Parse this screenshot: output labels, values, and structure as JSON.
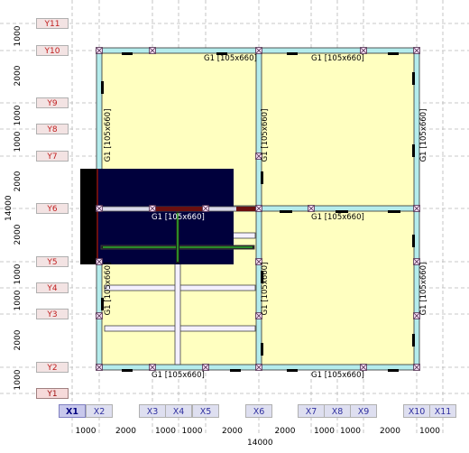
{
  "y_axes": [
    {
      "label": "Y11",
      "selected": false
    },
    {
      "label": "Y10",
      "selected": false
    },
    {
      "label": "Y9",
      "selected": false
    },
    {
      "label": "Y8",
      "selected": false
    },
    {
      "label": "Y7",
      "selected": false
    },
    {
      "label": "Y6",
      "selected": false
    },
    {
      "label": "Y5",
      "selected": false
    },
    {
      "label": "Y4",
      "selected": false
    },
    {
      "label": "Y3",
      "selected": false
    },
    {
      "label": "Y2",
      "selected": false
    },
    {
      "label": "Y1",
      "selected": true
    }
  ],
  "x_axes": [
    {
      "label": "X1",
      "selected": true
    },
    {
      "label": "X2",
      "selected": false
    },
    {
      "label": "X3",
      "selected": false
    },
    {
      "label": "X4",
      "selected": false
    },
    {
      "label": "X5",
      "selected": false
    },
    {
      "label": "X6",
      "selected": false
    },
    {
      "label": "X7",
      "selected": false
    },
    {
      "label": "X8",
      "selected": false
    },
    {
      "label": "X9",
      "selected": false
    },
    {
      "label": "X10",
      "selected": false
    },
    {
      "label": "X11",
      "selected": false
    }
  ],
  "y_dims": [
    "1000",
    "2000",
    "1000",
    "1000",
    "2000",
    "2000",
    "1000",
    "1000",
    "2000",
    "1000"
  ],
  "y_total": "14000",
  "x_dims": [
    "1000",
    "2000",
    "1000",
    "1000",
    "2000",
    "2000",
    "1000",
    "1000",
    "2000",
    "1000"
  ],
  "x_total": "14000",
  "beam_label": "G1 [105x660]",
  "colors": {
    "slab": "#ffffc0",
    "beam": "#b4ecec",
    "grid": "#b8b8b8",
    "selection": "#00003c"
  }
}
